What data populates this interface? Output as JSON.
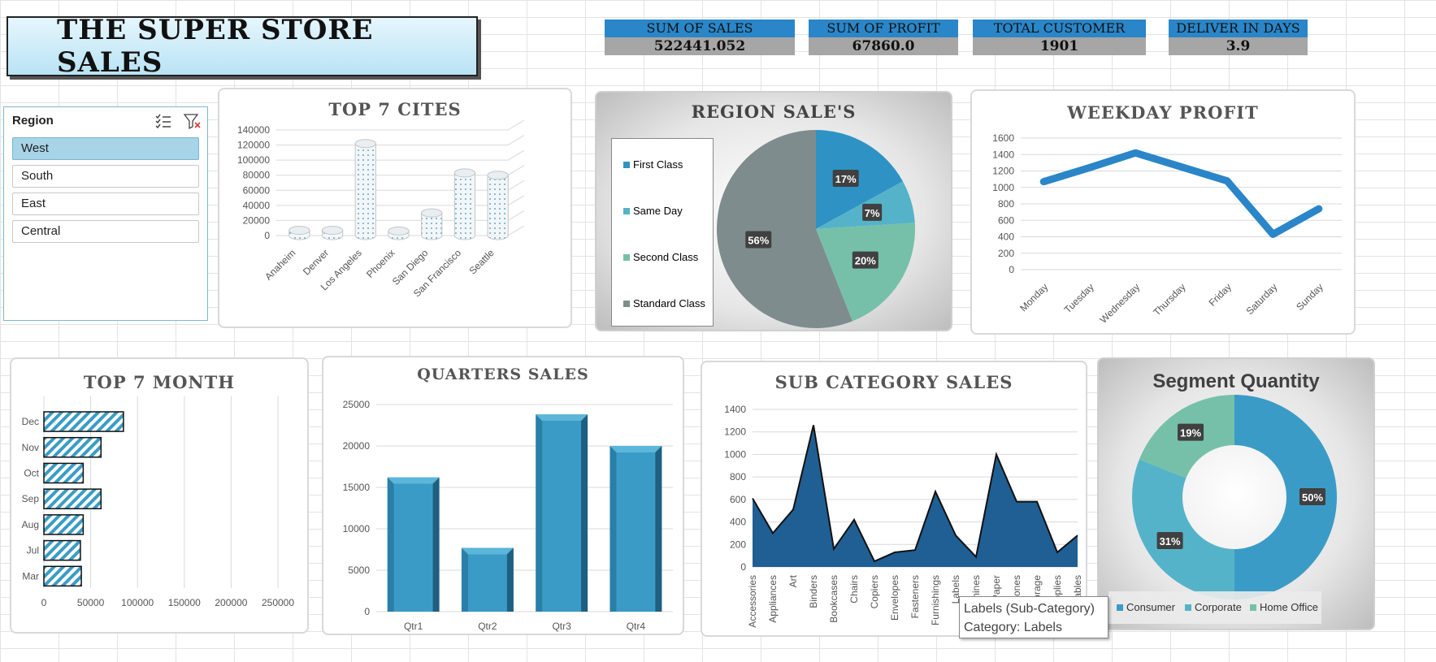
{
  "dashboard": {
    "title": "THE SUPER STORE SALES"
  },
  "kpis": [
    {
      "label": "SUM OF SALES",
      "value": "522441.052"
    },
    {
      "label": "SUM OF PROFIT",
      "value": "67860.0"
    },
    {
      "label": "TOTAL CUSTOMER",
      "value": "1901"
    },
    {
      "label": "DELIVER IN DAYS",
      "value": "3.9"
    }
  ],
  "slicer": {
    "title": "Region",
    "items": [
      "West",
      "South",
      "East",
      "Central"
    ],
    "selected": "West"
  },
  "tooltip": {
    "line1": "Labels (Sub-Category)",
    "line2": "Category: Labels"
  },
  "colors": {
    "accent": "#2a86c8",
    "bar": "#3a9cc6",
    "area": "#1f5f93",
    "line": "#2a86c8"
  },
  "chart_data": [
    {
      "id": "cities",
      "type": "bar",
      "title": "TOP 7 CITES",
      "categories": [
        "Anaheim",
        "Denver",
        "Los Angeles",
        "Phoenix",
        "San Diego",
        "San Francisco",
        "Seattle"
      ],
      "values": [
        7000,
        7000,
        122000,
        6000,
        30000,
        83000,
        80000
      ],
      "ylim": [
        0,
        140000
      ],
      "yticks": [
        "0",
        "20000",
        "40000",
        "60000",
        "80000",
        "100000",
        "120000",
        "140000"
      ]
    },
    {
      "id": "region",
      "type": "pie",
      "title": "REGION  SALE'S",
      "labels": [
        "First Class",
        "Same Day",
        "Second Class",
        "Standard Class"
      ],
      "values": [
        17,
        7,
        20,
        56
      ],
      "value_labels": [
        "17%",
        "7%",
        "20%",
        "56%"
      ],
      "colors": [
        "#2e93c4",
        "#55b3c9",
        "#76c0a9",
        "#7f8c8d"
      ]
    },
    {
      "id": "weekday",
      "type": "line",
      "title": "WEEKDAY PROFIT",
      "categories": [
        "Monday",
        "Tuesday",
        "Wednesday",
        "Thursday",
        "Friday",
        "Saturday",
        "Sunday"
      ],
      "values": [
        1070,
        1240,
        1420,
        1250,
        1080,
        430,
        740
      ],
      "ylim": [
        0,
        1600
      ],
      "yticks": [
        "0",
        "200",
        "400",
        "600",
        "800",
        "1000",
        "1200",
        "1400",
        "1600"
      ]
    },
    {
      "id": "months",
      "type": "bar",
      "title": "TOP 7 MONTH",
      "categories": [
        "Dec",
        "Nov",
        "Oct",
        "Sep",
        "Aug",
        "Jul",
        "Mar"
      ],
      "values": [
        85000,
        61000,
        42000,
        61000,
        42000,
        39000,
        40000
      ],
      "xlim": [
        0,
        250000
      ],
      "xticks": [
        "0",
        "50000",
        "100000",
        "150000",
        "200000",
        "250000"
      ]
    },
    {
      "id": "quarters",
      "type": "bar",
      "title": "QUARTERS  SALES",
      "categories": [
        "Qtr1",
        "Qtr2",
        "Qtr3",
        "Qtr4"
      ],
      "values": [
        16200,
        7700,
        23800,
        20000
      ],
      "ylim": [
        0,
        25000
      ],
      "yticks": [
        "0",
        "5000",
        "10000",
        "15000",
        "20000",
        "25000"
      ]
    },
    {
      "id": "subcat",
      "type": "area",
      "title": "SUB CATEGORY SALES",
      "categories": [
        "Accessories",
        "Appliances",
        "Art",
        "Binders",
        "Bookcases",
        "Chairs",
        "Copiers",
        "Envelopes",
        "Fasteners",
        "Furnishings",
        "Labels",
        "Machines",
        "Paper",
        "Phones",
        "Storage",
        "Supplies",
        "Tables"
      ],
      "values": [
        610,
        300,
        510,
        1260,
        160,
        420,
        50,
        130,
        150,
        670,
        280,
        90,
        1000,
        580,
        580,
        130,
        280
      ],
      "ylim": [
        0,
        1400
      ],
      "yticks": [
        "0",
        "200",
        "400",
        "600",
        "800",
        "1000",
        "1200",
        "1400"
      ]
    },
    {
      "id": "segment",
      "type": "pie",
      "title": "Segment Quantity",
      "labels": [
        "Consumer",
        "Corporate",
        "Home Office"
      ],
      "values": [
        50,
        31,
        19
      ],
      "value_labels": [
        "50%",
        "31%",
        "19%"
      ],
      "colors": [
        "#3a9cc6",
        "#55b3c9",
        "#76c0a9"
      ]
    }
  ]
}
